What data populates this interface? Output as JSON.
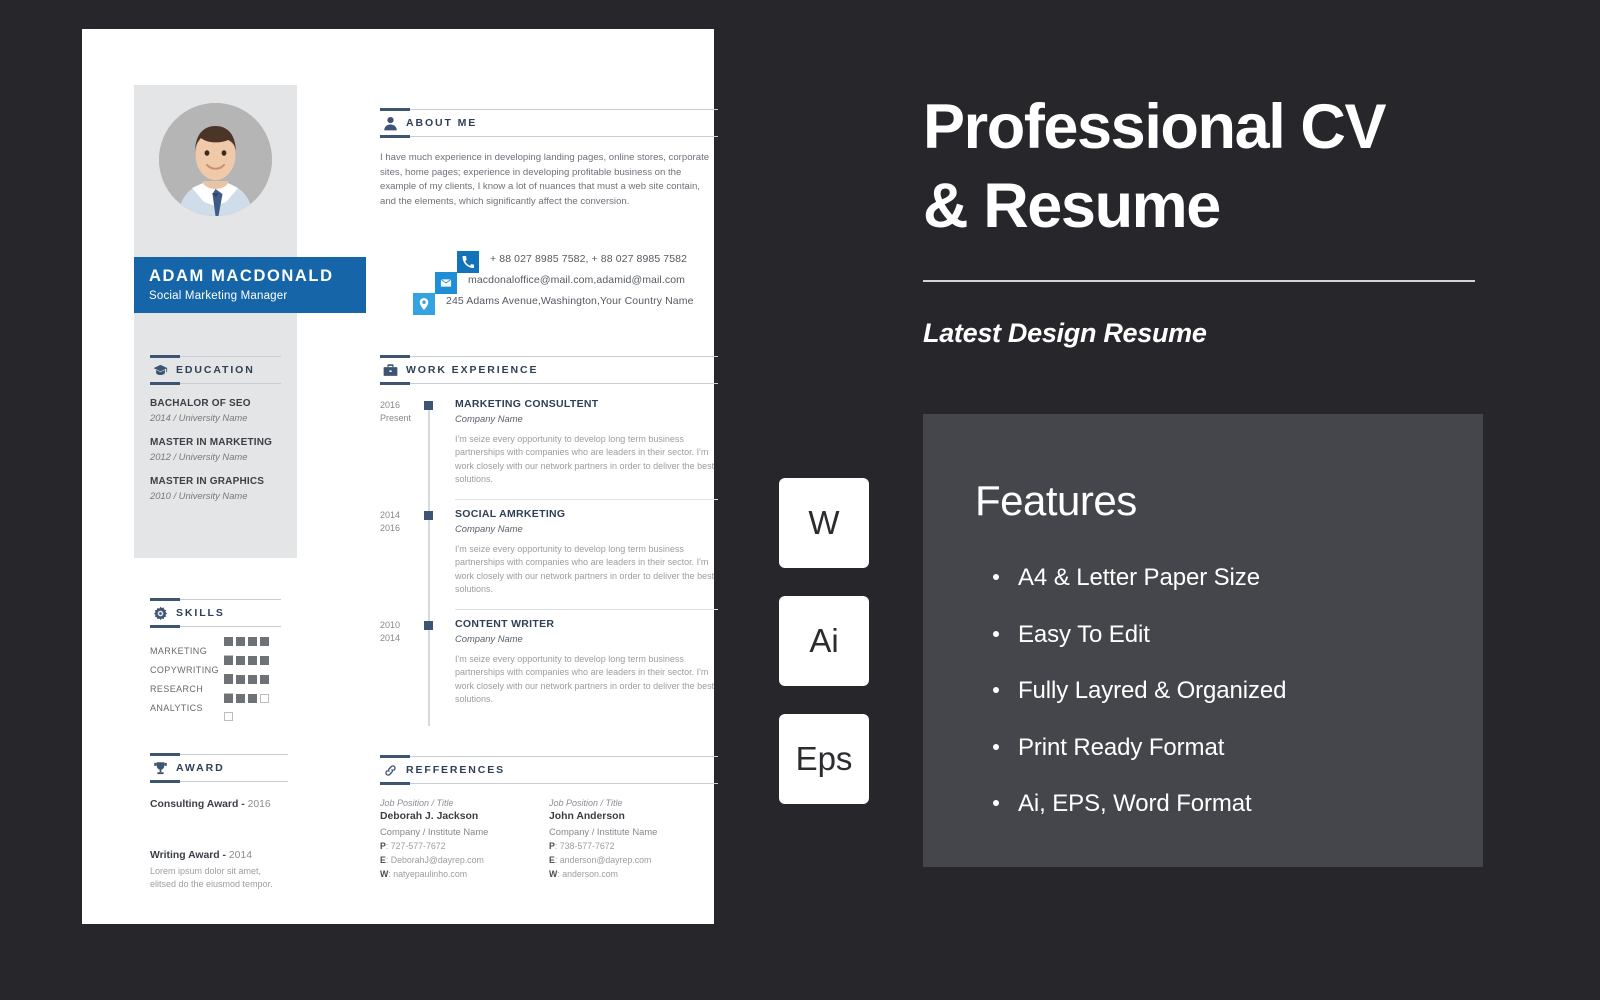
{
  "resume": {
    "person": {
      "name": "ADAM MACDONALD",
      "role": "Social Marketing Manager"
    },
    "contact": [
      {
        "icon": "phone-icon",
        "text": "+ 88 027 8985 7582, + 88 027 8985 7582"
      },
      {
        "icon": "mail-icon",
        "text": "macdonaloffice@mail.com,adamid@mail.com"
      },
      {
        "icon": "location-pin-icon",
        "text": "245 Adams Avenue,Washington,Your Country Name"
      }
    ],
    "about": {
      "heading": "ABOUT ME",
      "icon": "user-icon",
      "text": "I have much experience in developing landing pages, online stores, corporate sites, home pages; experience in developing profitable business on the example of my clients, I know a lot of nuances that must a web site contain, and the elements, which significantly affect the conversion."
    },
    "education": {
      "heading": "EDUCATION",
      "icon": "graduation-cap-icon",
      "items": [
        {
          "title": "BACHALOR OF SEO",
          "sub": "2014 / University Name"
        },
        {
          "title": "MASTER IN MARKETING",
          "sub": "2012 / University Name"
        },
        {
          "title": "MASTER IN GRAPHICS",
          "sub": "2010 / University Name"
        }
      ]
    },
    "skills": {
      "heading": "SKILLS",
      "icon": "gear-icon",
      "max": 5,
      "items": [
        {
          "label": "MARKETING",
          "level": 4
        },
        {
          "label": "COPYWRITING",
          "level": 5
        },
        {
          "label": "RESEARCH",
          "level": 4
        },
        {
          "label": "ANALYTICS",
          "level": 3
        }
      ]
    },
    "award": {
      "heading": "AWARD",
      "icon": "trophy-icon",
      "items": [
        {
          "title": "Consulting Award - ",
          "year": "2016",
          "desc": ""
        },
        {
          "title": "Writing Award - ",
          "year": "2014",
          "desc": "Lorem ipsum dolor sit amet, elitsed do the eiusmod tempor."
        }
      ]
    },
    "work": {
      "heading": "WORK EXPERIENCE",
      "icon": "briefcase-icon",
      "jobs": [
        {
          "year_from": "2016",
          "year_to": "Present",
          "title": "MARKETING CONSULTENT",
          "company": "Company Name",
          "desc": "I'm seize every opportunity to develop long term business partnerships with companies who are leaders in their sector. I'm work closely with our network partners in order to deliver the best solutions."
        },
        {
          "year_from": "2014",
          "year_to": "2016",
          "title": "SOCIAL AMRKETING",
          "company": "Company Name",
          "desc": "I'm seize every opportunity to develop long term business partnerships with companies who are leaders in their sector. I'm work closely with our network partners in order to deliver the best solutions."
        },
        {
          "year_from": "2010",
          "year_to": "2014",
          "title": "CONTENT WRITER",
          "company": "Company Name",
          "desc": "I'm seize every opportunity to develop long term business partnerships with companies who are leaders in their sector. I'm work closely with our network partners in order to deliver the best solutions."
        }
      ]
    },
    "references": {
      "heading": "REFFERENCES",
      "icon": "link-icon",
      "people": [
        {
          "position": "Job Position / Title",
          "name": "Deborah J. Jackson",
          "company": "Company / Institute Name",
          "phone_label": "P",
          "phone": ": 727-577-7672",
          "email_label": "E",
          "email": ": DeborahJ@dayrep.com",
          "web_label": "W",
          "web": ": natyepaulinho.com"
        },
        {
          "position": "Job Position / Title",
          "name": "John Anderson",
          "company": "Company / Institute Name",
          "phone_label": "P",
          "phone": ": 738-577-7672",
          "email_label": "E",
          "email": ": anderson@dayrep.com",
          "web_label": "W",
          "web": ": anderson.com"
        }
      ]
    }
  },
  "promo": {
    "title_line1": "Professional CV",
    "title_line2": "& Resume",
    "subtitle": "Latest Design Resume",
    "format_tiles": [
      {
        "label": "W",
        "name": "word-format-tile"
      },
      {
        "label": "Ai",
        "name": "illustrator-format-tile"
      },
      {
        "label": "Eps",
        "name": "eps-format-tile"
      }
    ],
    "features": {
      "title": "Features",
      "items": [
        "A4 & Letter Paper Size",
        "Easy To Edit",
        "Fully Layred & Organized",
        "Print Ready Format",
        "Ai, EPS, Word Format"
      ]
    }
  },
  "colors": {
    "page_background": "#26262b",
    "resume_background": "#ffffff",
    "sidebar_grey": "#e4e5e7",
    "accent_blue": "#1565a8",
    "icon_blue_1": "#1273bb",
    "icon_blue_2": "#1e8fd6",
    "icon_blue_3": "#35a2e2",
    "heading_navy": "#2f3f55",
    "features_box": "#45464b",
    "skill_filled": "#6e7277"
  }
}
